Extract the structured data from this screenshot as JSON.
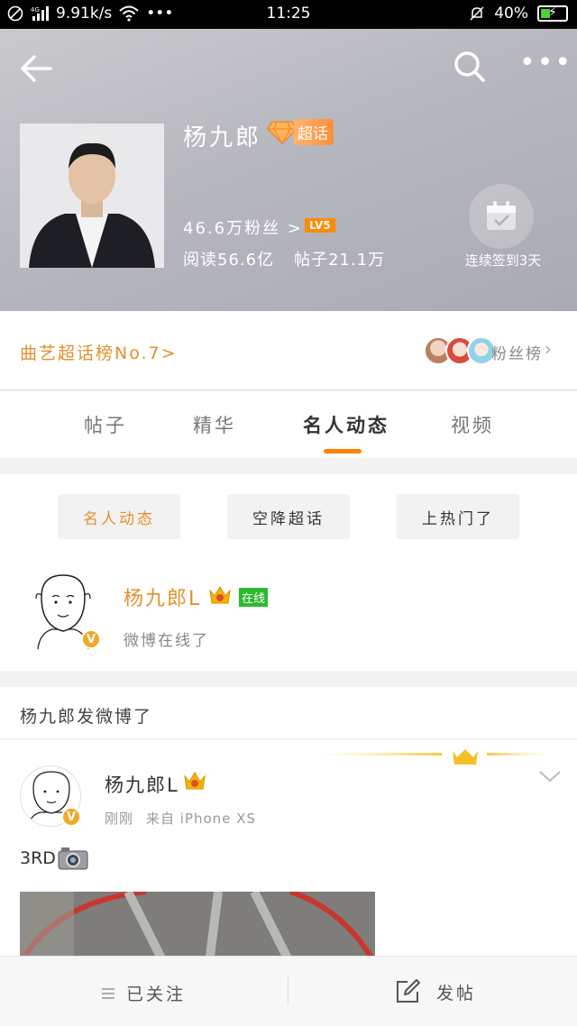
{
  "status_bar": {
    "net_speed": "9.91k/s",
    "time": "11:25",
    "battery": "40%",
    "battery_level": 0.4
  },
  "header": {
    "name": "杨九郎",
    "super_topic_badge": "超话",
    "fans": "46.6万粉丝 >",
    "level": "LV5",
    "reads": "阅读56.6亿",
    "posts": "帖子21.1万",
    "checkin_label": "连续签到3天",
    "icons": [
      "back-icon",
      "search-icon",
      "more-icon",
      "calendar-check-icon"
    ]
  },
  "rank": {
    "text": "曲艺超话榜No.7>",
    "fan_rank_label": "粉丝榜"
  },
  "tabs": [
    {
      "label": "帖子"
    },
    {
      "label": "精华"
    },
    {
      "label": "名人动态"
    },
    {
      "label": "视频"
    }
  ],
  "filters": [
    {
      "label": "名人动态"
    },
    {
      "label": "空降超话"
    },
    {
      "label": "上热门了"
    }
  ],
  "online_user": {
    "name": "杨九郎L",
    "tag": "在线",
    "status": "微博在线了"
  },
  "feed": {
    "header": "杨九郎发微博了",
    "post": {
      "author": "杨九郎L",
      "time": "刚刚",
      "source": "来自 iPhone XS",
      "text": "3RD"
    }
  },
  "bottom_bar": {
    "follow_label": "已关注",
    "post_label": "发帖"
  },
  "colors": {
    "accent": "#ff8200",
    "rank_text": "#e58f2b",
    "online_green": "#2eb82e"
  }
}
